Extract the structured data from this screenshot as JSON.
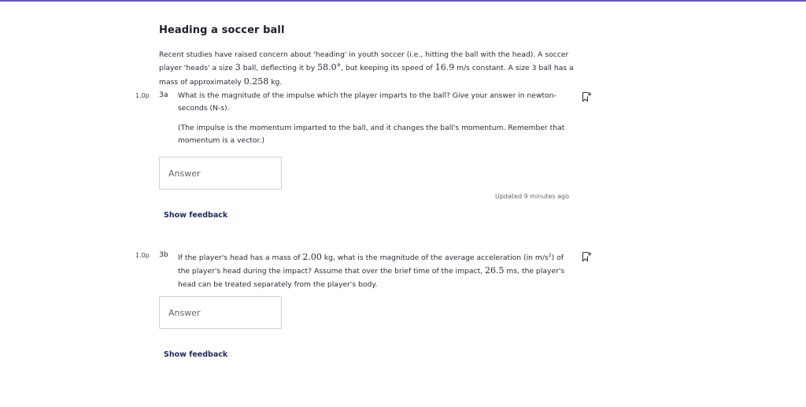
{
  "title": "Heading a soccer ball",
  "intro": {
    "line1": "Recent studies have raised concern about 'heading' in youth soccer (i.e., hitting the ball with the head). A soccer",
    "line2_a": "player 'heads' a size ",
    "line2_size": "3",
    "line2_b": " ball, deflecting it by ",
    "line2_angle": "58.0°",
    "line2_c": ", but keeping its speed of ",
    "line2_speed": "16.9",
    "line2_d": " m/s constant. A size 3 ball has a",
    "line3_a": "mass of approximately ",
    "line3_mass": "0.258",
    "line3_b": " kg."
  },
  "q3a": {
    "points": "1.0p",
    "number": "3a",
    "text_line1": "What is the magnitude of the impulse which the player imparts to the ball? Give your answer in newton-",
    "text_line2": "seconds (N-s).",
    "hint_line1": "(The impulse is the momentum imparted to the ball, and it changes the ball's momentum. Remember that",
    "hint_line2": "momentum is a vector.)",
    "answer_placeholder": "Answer",
    "updated": "Updated 9 minutes ago",
    "feedback": "Show feedback",
    "flag_icon": "flag-plus-icon"
  },
  "q3b": {
    "points": "1.0p",
    "number": "3b",
    "l1_a": "If the player's head has a mass of ",
    "l1_mass": "2.00",
    "l1_b": " kg, what is the magnitude of the average acceleration (in m/s",
    "l1_sup": "2",
    "l1_c": ") of",
    "l2_a": "the player's head during the impact? Assume that over the brief time of the impact, ",
    "l2_time": "26.5",
    "l2_b": " ms, the player's",
    "l3": "head can be treated separately from the player's body.",
    "answer_placeholder": "Answer",
    "feedback": "Show feedback",
    "flag_icon": "flag-plus-icon"
  },
  "colors": {
    "accent": "#6a4fd6",
    "link": "#1d2a5c"
  }
}
